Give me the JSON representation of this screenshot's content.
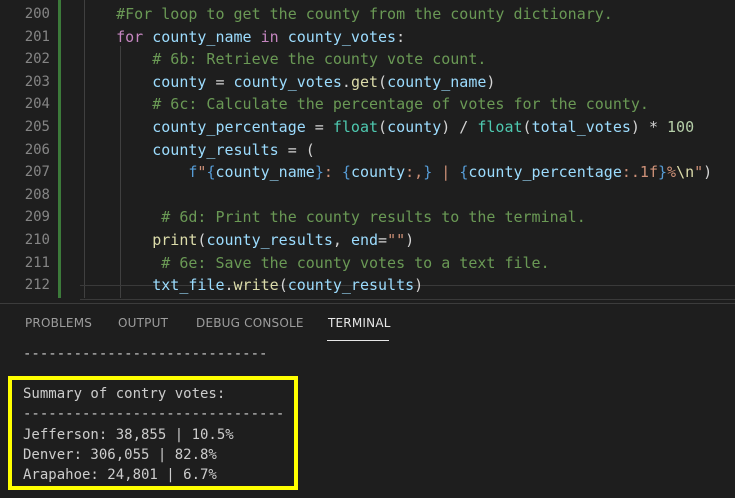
{
  "editor": {
    "lines": [
      {
        "n": "200",
        "code": "    #For loop to get the county from the county dictionary."
      },
      {
        "n": "201",
        "code": "    for county_name in county_votes:"
      },
      {
        "n": "202",
        "code": "        # 6b: Retrieve the county vote count."
      },
      {
        "n": "203",
        "code": "        county = county_votes.get(county_name)"
      },
      {
        "n": "204",
        "code": "        # 6c: Calculate the percentage of votes for the county."
      },
      {
        "n": "205",
        "code": "        county_percentage = float(county) / float(total_votes) * 100"
      },
      {
        "n": "206",
        "code": "        county_results = ("
      },
      {
        "n": "207",
        "code": "            f\"{county_name}: {county:,} | {county_percentage:.1f}%\\n\")"
      },
      {
        "n": "208",
        "code": ""
      },
      {
        "n": "209",
        "code": "         # 6d: Print the county results to the terminal."
      },
      {
        "n": "210",
        "code": "        print(county_results, end=\"\")"
      },
      {
        "n": "211",
        "code": "         # 6e: Save the county votes to a text file."
      },
      {
        "n": "212",
        "code": "        txt_file.write(county_results)"
      }
    ]
  },
  "panel": {
    "tabs": [
      "PROBLEMS",
      "OUTPUT",
      "DEBUG CONSOLE",
      "TERMINAL"
    ],
    "active_tab": "TERMINAL"
  },
  "terminal": {
    "top_rule": "-----------------------------",
    "summary_title": "Summary of contry votes:",
    "rule": "-------------------------------",
    "rows": [
      "Jefferson: 38,855 | 10.5%",
      "Denver: 306,055 | 82.8%",
      "Arapahoe: 24,801 | 6.7%"
    ]
  },
  "colors": {
    "background": "#1e1e1e",
    "highlight_box": "#ffff00",
    "comment": "#6a9955",
    "keyword": "#c586c0",
    "variable": "#9cdcfe"
  }
}
